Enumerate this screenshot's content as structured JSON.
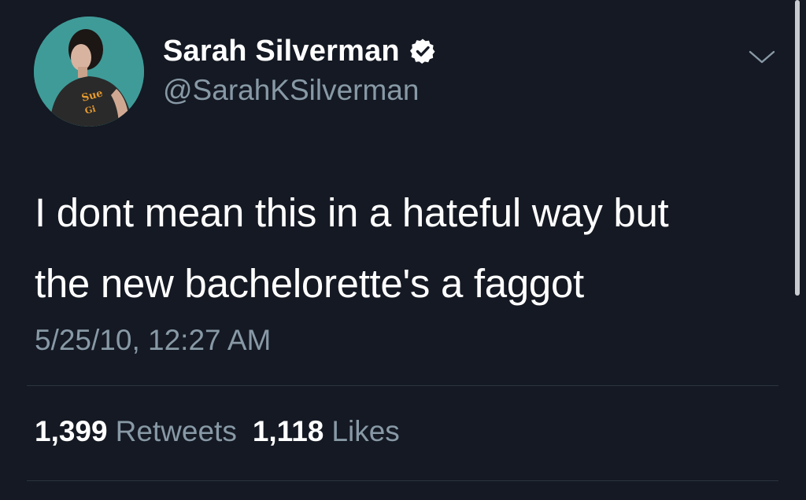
{
  "tweet": {
    "author": {
      "display_name": "Sarah Silverman",
      "handle": "@SarahKSilverman",
      "verified": true,
      "avatar_icon": "profile-photo"
    },
    "text_lines": [
      "I dont mean this in a hateful way but",
      "the new bachelorette's a faggot"
    ],
    "timestamp": "5/25/10, 12:27 AM",
    "stats": {
      "retweets_count": "1,399",
      "retweets_label": "Retweets",
      "likes_count": "1,118",
      "likes_label": "Likes"
    },
    "menu_icon": "chevron-down-icon"
  },
  "colors": {
    "background": "#141923",
    "primary_text": "#ffffff",
    "secondary_text": "#8899a6",
    "verified_badge": "#ffffff",
    "divider": "#2c3540",
    "avatar_background": "#3f9b98"
  }
}
